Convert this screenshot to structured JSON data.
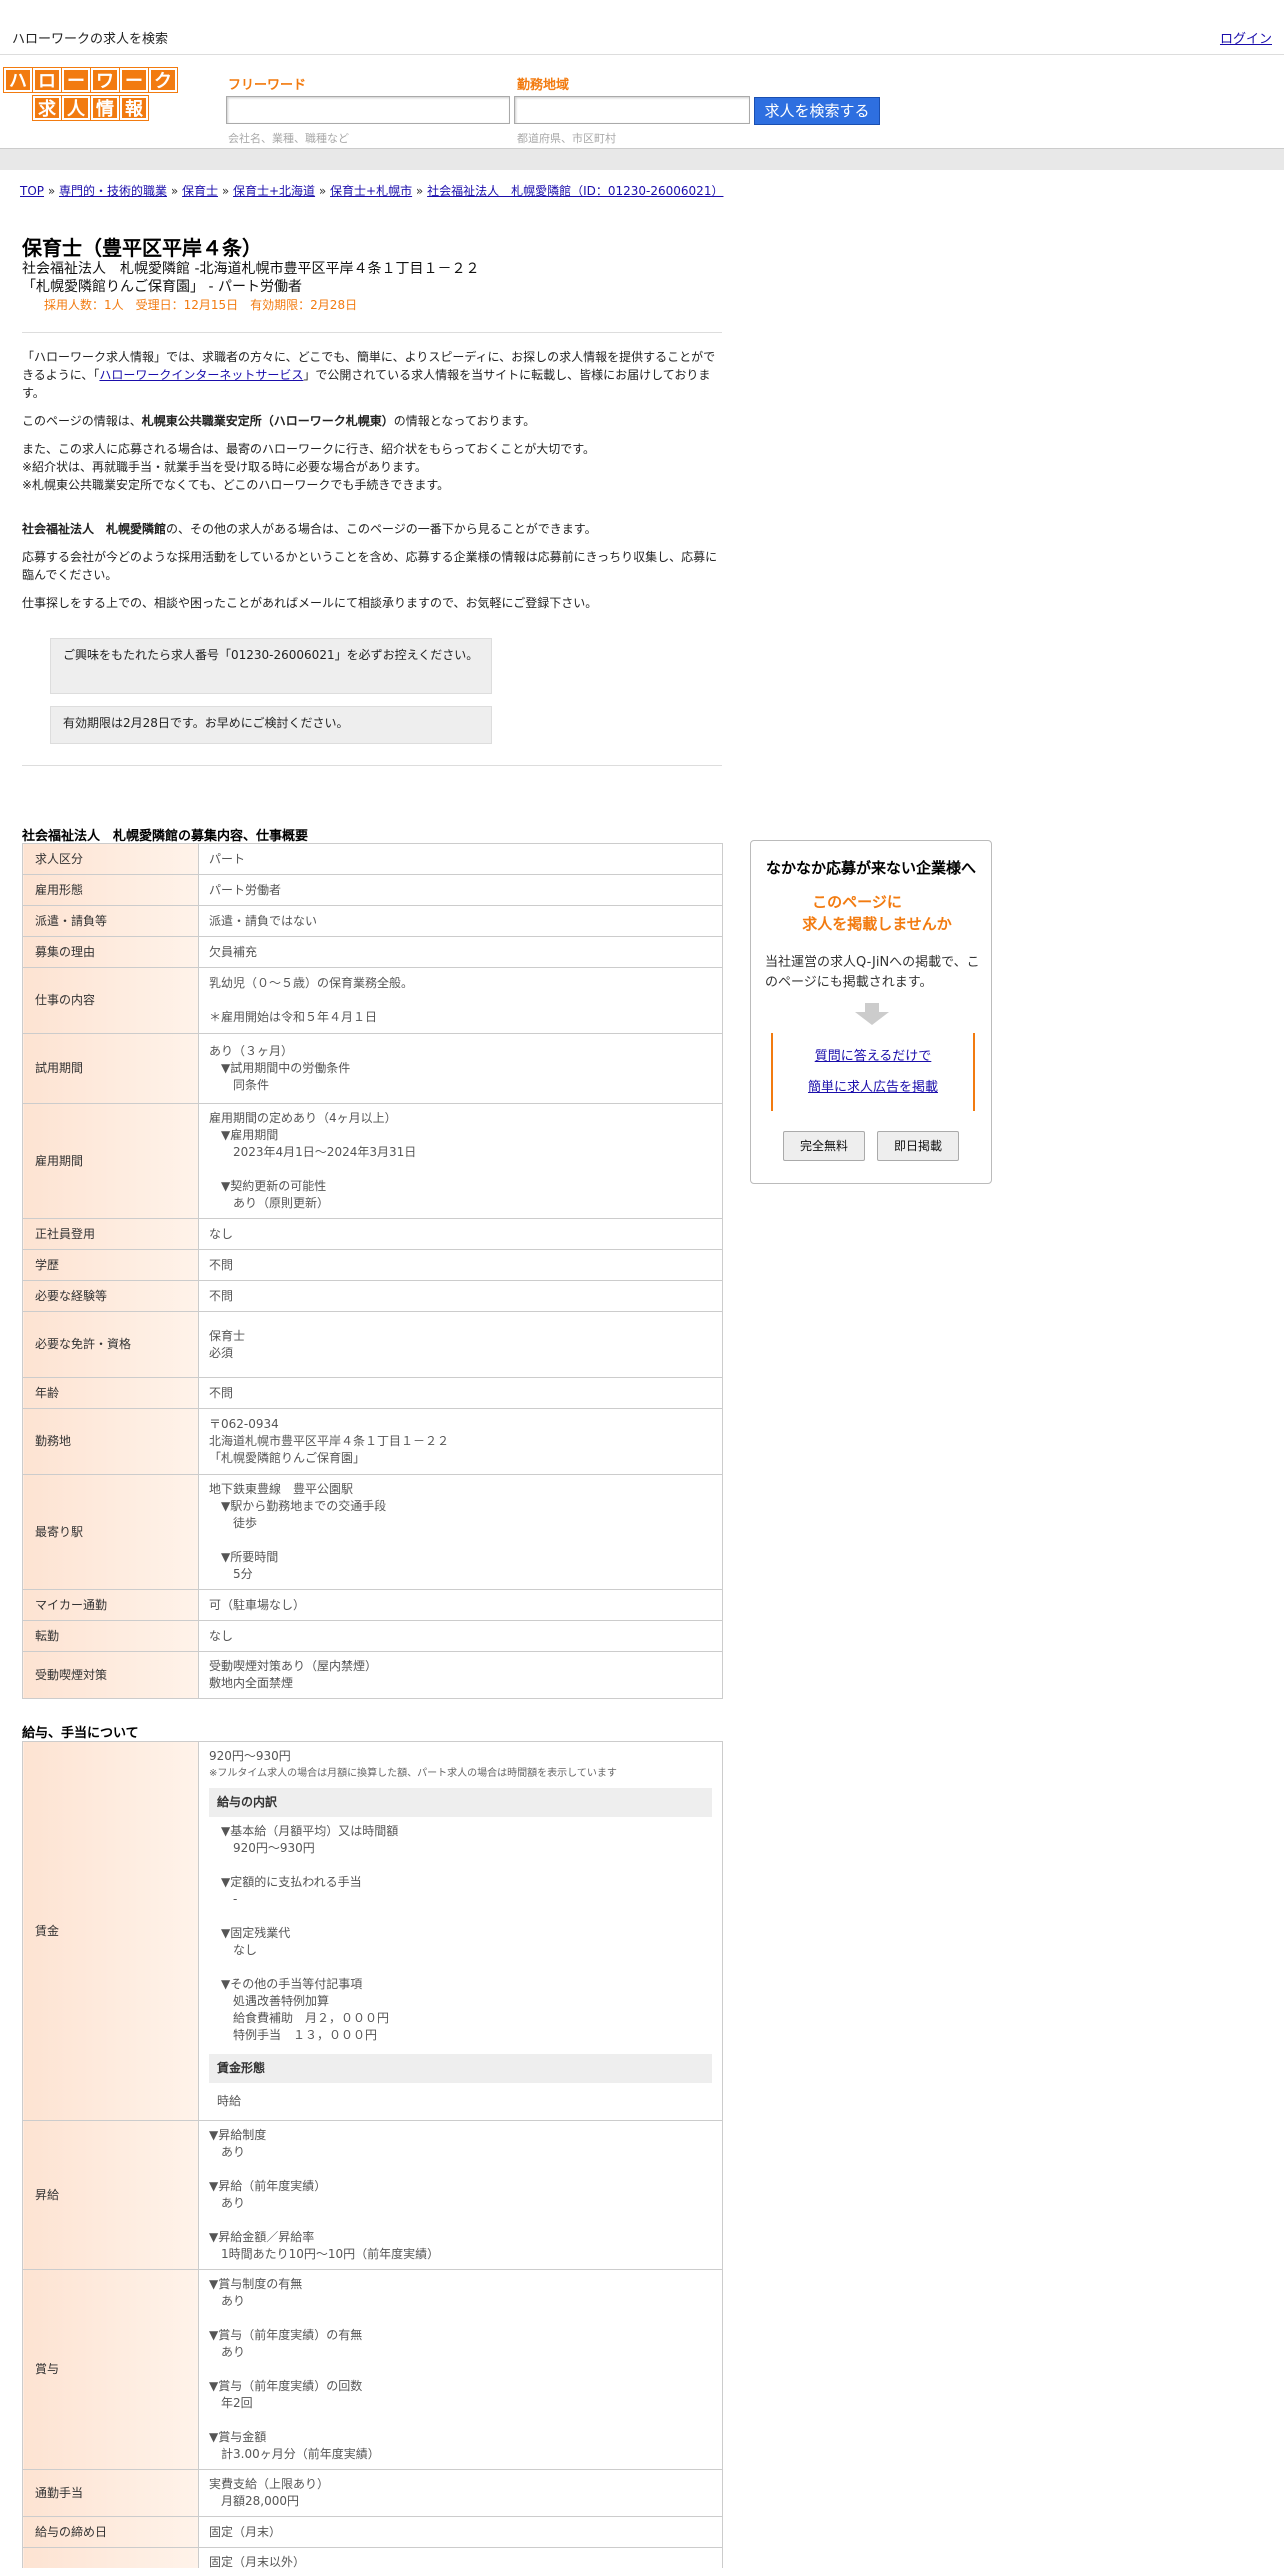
{
  "header": {
    "search_title": "ハローワークの求人を検索",
    "login": "ログイン"
  },
  "logo": {
    "row1": [
      "ハ",
      "ロ",
      "ー",
      "ワ",
      "ー",
      "ク"
    ],
    "row2": [
      "求",
      "人",
      "情",
      "報"
    ]
  },
  "search": {
    "free_label": "フリーワード",
    "free_hint": "会社名、業種、職種など",
    "area_label": "勤務地域",
    "area_hint": "都道府県、市区町村",
    "button": "求人を検索する"
  },
  "breadcrumb": [
    "TOP",
    "専門的・技術的職業",
    "保育士",
    "保育士+北海道",
    "保育士+札幌市",
    "社会福祉法人　札幌愛隣館（ID：01230-26006021）"
  ],
  "job": {
    "title": "保育士（豊平区平岸４条）",
    "line1": "社会福祉法人　札幌愛隣館 -北海道札幌市豊平区平岸４条１丁目１－２２",
    "line2": "「札幌愛隣館りんご保育園」 - パート労働者",
    "meta": "採用人数：1人　受理日：12月15日　有効期限：2月28日"
  },
  "intro": {
    "p1a": "「ハローワーク求人情報」では、求職者の方々に、どこでも、簡単に、よりスピーディに、お探しの求人情報を提供することができるように、「",
    "p1link": "ハローワークインターネットサービス",
    "p1b": "」で公開されている求人情報を当サイトに転載し、皆様にお届けしております。",
    "p2a": "このページの情報は、",
    "p2b": "札幌東公共職業安定所（ハローワーク札幌東）",
    "p2c": "の情報となっております。",
    "p3": "また、この求人に応募される場合は、最寄のハローワークに行き、紹介状をもらっておくことが大切です。",
    "p4": "※紹介状は、再就職手当・就業手当を受け取る時に必要な場合があります。",
    "p5": "※札幌東公共職業安定所でなくても、どこのハローワークでも手続きできます。",
    "p6a": "社会福祉法人　札幌愛隣館",
    "p6b": "の、その他の求人がある場合は、このページの一番下から見ることができます。",
    "p7": "応募する会社が今どのような採用活動をしているかということを含め、応募する企業様の情報は応募前にきっちり収集し、応募に臨んでください。",
    "p8": "仕事探しをする上での、相談や困ったことがあればメールにて相談承りますので、お気軽にご登録下さい。",
    "note1": "ご興味をもたれたら求人番号「01230-26006021」を必ずお控えください。",
    "note2": "有効期限は2月28日です。お早めにご検討ください。"
  },
  "section1": "社会福祉法人　札幌愛隣館の募集内容、仕事概要",
  "rows1": [
    {
      "k": "求人区分",
      "v": "パート"
    },
    {
      "k": "雇用形態",
      "v": "パート労働者"
    },
    {
      "k": "派遣・請負等",
      "v": "派遣・請負ではない"
    },
    {
      "k": "募集の理由",
      "v": "欠員補充"
    },
    {
      "k": "仕事の内容",
      "v": "乳幼児（０～５歳）の保育業務全般。\n\n＊雇用開始は令和５年４月１日"
    },
    {
      "k": "試用期間",
      "v": "あり（３ヶ月）\n　▼試用期間中の労働条件\n　　同条件"
    },
    {
      "k": "雇用期間",
      "v": "雇用期間の定めあり（4ヶ月以上）\n　▼雇用期間\n　　2023年4月1日〜2024年3月31日\n\n　▼契約更新の可能性\n　　あり（原則更新）"
    },
    {
      "k": "正社員登用",
      "v": "なし"
    },
    {
      "k": "学歴",
      "v": "不問"
    },
    {
      "k": "必要な経験等",
      "v": "不問"
    },
    {
      "k": "必要な免許・資格",
      "v": "保育士\n必須\n"
    },
    {
      "k": "年齢",
      "v": "不問"
    },
    {
      "k": "勤務地",
      "v": "〒062-0934\n北海道札幌市豊平区平岸４条１丁目１－２２\n「札幌愛隣館りんご保育園」"
    },
    {
      "k": "最寄り駅",
      "v": "地下鉄東豊線　豊平公園駅\n　▼駅から勤務地までの交通手段\n　　徒歩\n\n　▼所要時間\n　　5分"
    },
    {
      "k": "マイカー通勤",
      "v": "可（駐車場なし）"
    },
    {
      "k": "転勤",
      "v": "なし"
    },
    {
      "k": "受動喫煙対策",
      "v": "受動喫煙対策あり（屋内禁煙）\n敷地内全面禁煙"
    }
  ],
  "section2": "給与、手当について",
  "wage": {
    "k": "賃金",
    "top": "920円〜930円",
    "note": "※フルタイム求人の場合は月額に換算した額、パート求人の場合は時間額を表示しています",
    "inner1": "給与の内訳",
    "items": "▼基本給（月額平均）又は時間額\n　920円〜930円\n\n▼定額的に支払われる手当\n　-\n\n▼固定残業代\n　なし\n\n▼その他の手当等付記事項\n　処遇改善特例加算\n　給食費補助　月２，０００円\n　特例手当　１３，０００円",
    "inner2": "賃金形態",
    "form": "時給"
  },
  "rows2": [
    {
      "k": "昇給",
      "v": "▼昇給制度\n　あり\n\n▼昇給（前年度実績）\n　あり\n\n▼昇給金額／昇給率\n　1時間あたり10円〜10円（前年度実績）"
    },
    {
      "k": "賞与",
      "v": "▼賞与制度の有無\n　あり\n\n▼賞与（前年度実績）の有無\n　あり\n\n▼賞与（前年度実績）の回数\n　年2回\n\n▼賞与金額\n　計3.00ヶ月分（前年度実績）"
    },
    {
      "k": "通勤手当",
      "v": "実費支給（上限あり）\n　月額28,000円"
    },
    {
      "k": "給与の締め日",
      "v": "固定（月末）"
    },
    {
      "k": "",
      "v": "固定（月末以外）\n▼支払月"
    }
  ],
  "ad": {
    "heading": "なかなか応募が来ない企業様へ",
    "orange1": "このページに",
    "orange2": "求人を掲載しませんか",
    "desc": "当社運営の求人Q-JiNへの掲載で、このページにも掲載されます。",
    "link1": "質問に答えるだけで",
    "link2": "簡単に求人広告を掲載",
    "btn1": "完全無料",
    "btn2": "即日掲載"
  }
}
